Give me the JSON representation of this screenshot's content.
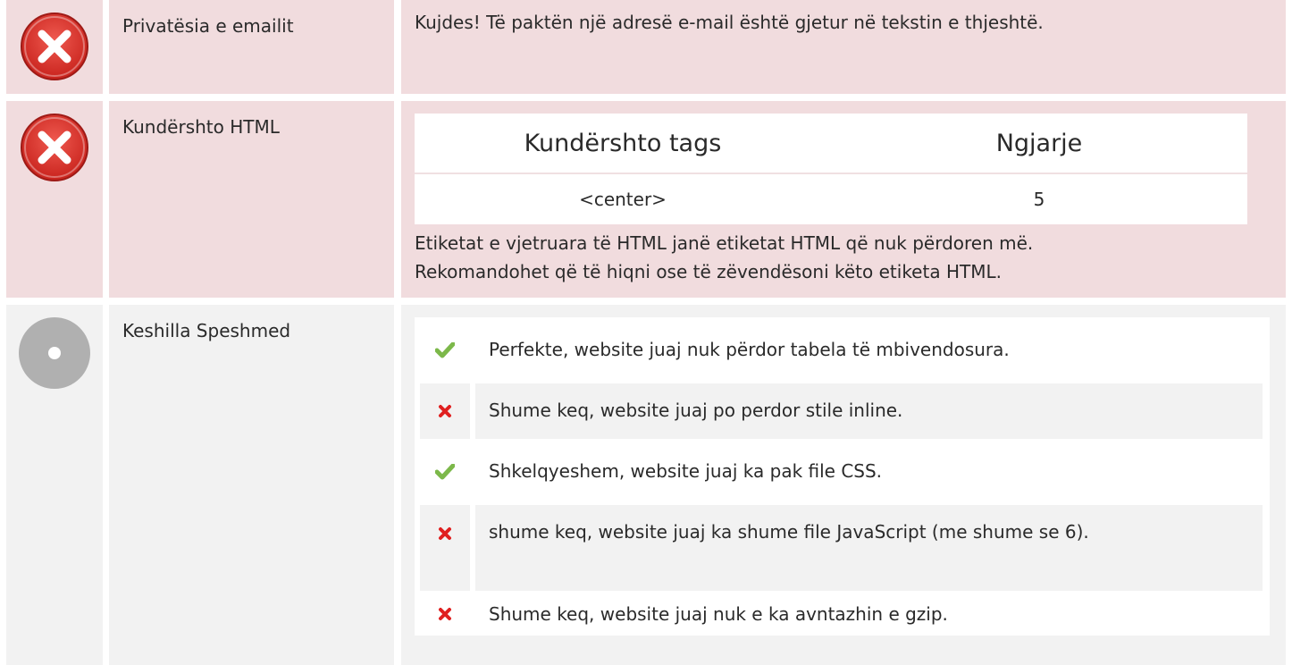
{
  "rows": [
    {
      "label": "Privatësia e emailit",
      "status": "error",
      "text": "Kujdes! Të paktën një adresë e-mail është gjetur në tekstin e thjeshtë."
    },
    {
      "label": "Kundërshto HTML",
      "status": "error",
      "table": {
        "headers": [
          "Kundërshto tags",
          "Ngjarje"
        ],
        "rows": [
          [
            "<center>",
            "5"
          ]
        ]
      },
      "note_line1": "Etiketat e vjetruara të HTML janë etiketat HTML që nuk përdoren më.",
      "note_line2": "Rekomandohet që të hiqni ose të zëvendësoni këto etiketa HTML."
    },
    {
      "label": "Keshilla Speshmed",
      "status": "neutral",
      "advice": [
        {
          "ok": true,
          "text": "Perfekte, website juaj nuk përdor tabela të mbivendosura."
        },
        {
          "ok": false,
          "text": "Shume keq, website juaj po perdor stile inline."
        },
        {
          "ok": true,
          "text": "Shkelqyeshem, website juaj ka pak file CSS."
        },
        {
          "ok": false,
          "text": "shume keq, website juaj ka shume file JavaScript (me shume se 6)."
        },
        {
          "ok": false,
          "text": "Shume keq, website juaj nuk e ka avntazhin e gzip."
        }
      ]
    }
  ],
  "colors": {
    "error_bg": "#f1dcde",
    "neutral_bg": "#f2f2f2",
    "error_icon": "#d9302c",
    "neutral_icon": "#b0b0b0",
    "check": "#7cb84a",
    "cross": "#e02020"
  }
}
